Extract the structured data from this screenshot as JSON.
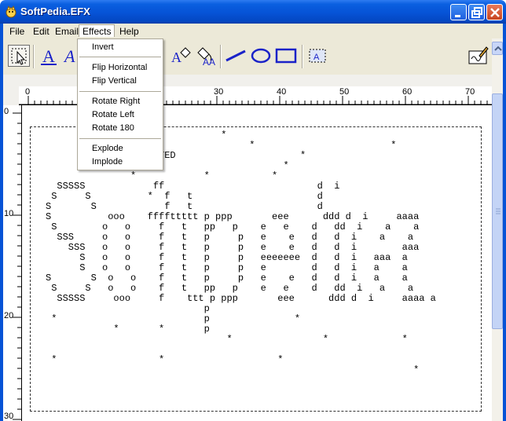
{
  "window": {
    "title": "SoftPedia.EFX"
  },
  "menu": [
    {
      "label": "File"
    },
    {
      "label": "Edit"
    },
    {
      "label": "Email"
    },
    {
      "label": "Effects"
    },
    {
      "label": "Help"
    }
  ],
  "effects_menu": {
    "items": [
      "Invert",
      "Flip Horizontal",
      "Flip Vertical",
      "Rotate Right",
      "Rotate Left",
      "Rotate 180",
      "Explode",
      "Implode"
    ]
  },
  "ruler": {
    "horizontal": [
      "0",
      "30",
      "40",
      "50",
      "60",
      "70"
    ],
    "vertical": [
      "0",
      "10",
      "20",
      "30"
    ]
  },
  "canvas": {
    "lines": [
      "                               *",
      "                                    *                        *",
      "                 TESTED                      *",
      "                                          *",
      "               *            *           *",
      "  SSSSS            ff                           d  i",
      " S     S          *  f   t                      d",
      "S       S            f   t                      d",
      "S          ooo    ffffttttt p ppp       eee      ddd d  i     aaaa",
      " S        o   o     f   t   pp   p    e   e    d   dd  i    a    a",
      "  SSS     o   o     f   t   p     p   e    e   d   d  i    a    a",
      "    SSS   o   o     f   t   p     p   e    e   d   d  i        aaa",
      "      S   o   o     f   t   p     p   eeeeeee  d   d  i   aaa  a",
      "      S   o   o     f   t   p     p   e        d   d  i   a    a",
      "S       S  o   o    f   t   p     p   e    e   d   d  i   a    a",
      " S     S   o   o    f   t   pp   p    e   e    d   dd  i   a    a",
      "  SSSSS     ooo     f    ttt p ppp       eee      ddd d  i     aaaa a",
      "                            p",
      " *                          p               *",
      "            *       *       p",
      "                                *                *             *",
      "",
      " *                  *                    *",
      "                                                                 *"
    ]
  },
  "colors": {
    "titlebar": "#0653d6",
    "menubar": "#ece9d8",
    "text_tool": "#1a22c8"
  },
  "icons": [
    "select-icon",
    "text-a-icon",
    "text-a-italic-icon",
    "eraser-icon",
    "fill-bucket-icon",
    "line-icon",
    "ellipse-icon",
    "rectangle-icon",
    "text-box-icon",
    "signature-icon"
  ]
}
